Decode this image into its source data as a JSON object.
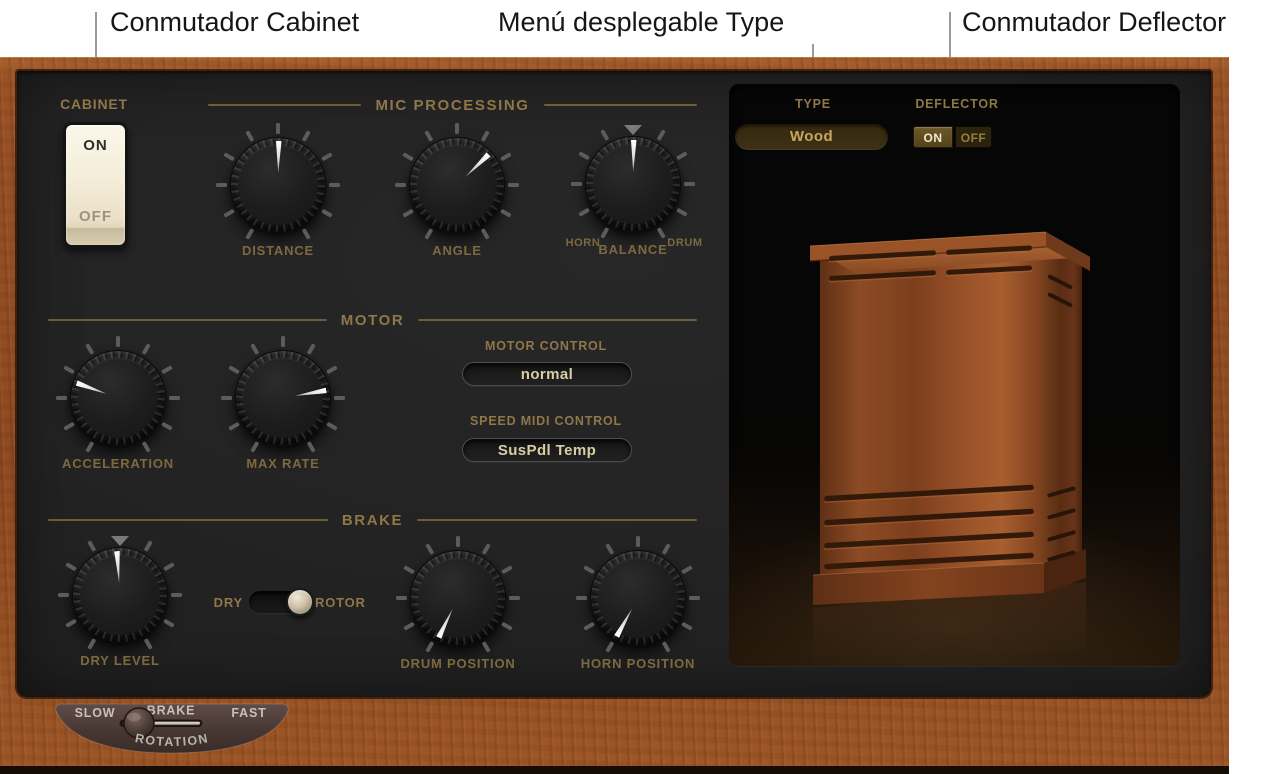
{
  "annotations": {
    "cabinet": "Conmutador Cabinet",
    "type": "Menú desplegable Type",
    "deflector": "Conmutador Deflector"
  },
  "cabinet_switch": {
    "label": "CABINET",
    "on": "ON",
    "off": "OFF",
    "state": "ON"
  },
  "sections": {
    "mic_processing": {
      "title": "MIC PROCESSING"
    },
    "motor": {
      "title": "MOTOR"
    },
    "brake": {
      "title": "BRAKE"
    }
  },
  "knobs": {
    "distance": {
      "label": "DISTANCE",
      "angle": 1
    },
    "angle": {
      "label": "ANGLE",
      "angle": 46
    },
    "balance": {
      "label": "BALANCE",
      "angle": 1,
      "marker": true,
      "left": "HORN",
      "right": "DRUM"
    },
    "acceleration": {
      "label": "ACCELERATION",
      "angle": -70
    },
    "max_rate": {
      "label": "MAX RATE",
      "angle": 80
    },
    "dry_level": {
      "label": "DRY LEVEL",
      "angle": -4,
      "marker": true
    },
    "drum_position": {
      "label": "DRUM POSITION",
      "angle": -154
    },
    "horn_position": {
      "label": "HORN POSITION",
      "angle": -151
    }
  },
  "dropdowns": {
    "motor_control": {
      "label": "MOTOR CONTROL",
      "value": "normal"
    },
    "speed_midi_control": {
      "label": "SPEED MIDI CONTROL",
      "value": "SusPdl Temp"
    },
    "type": {
      "label": "TYPE",
      "value": "Wood"
    }
  },
  "deflector": {
    "label": "DEFLECTOR",
    "on": "ON",
    "off": "OFF",
    "state": "ON"
  },
  "dry_rotor_toggle": {
    "left": "DRY",
    "right": "ROTOR",
    "state": "ROTOR"
  },
  "rotation": {
    "label": "ROTATION",
    "options": [
      "SLOW",
      "BRAKE",
      "FAST"
    ],
    "selected": "SLOW"
  },
  "colors": {
    "gold_label": "#8f7748",
    "cream_value_text": "#dacda6",
    "panel": "#212121",
    "wood_frame": "#96522a",
    "switch_cream": "#f4edd9",
    "type_value_text": "#c9a65f",
    "deflector_active_bg": "#5f4d22",
    "needle_white": "#ffffff"
  }
}
